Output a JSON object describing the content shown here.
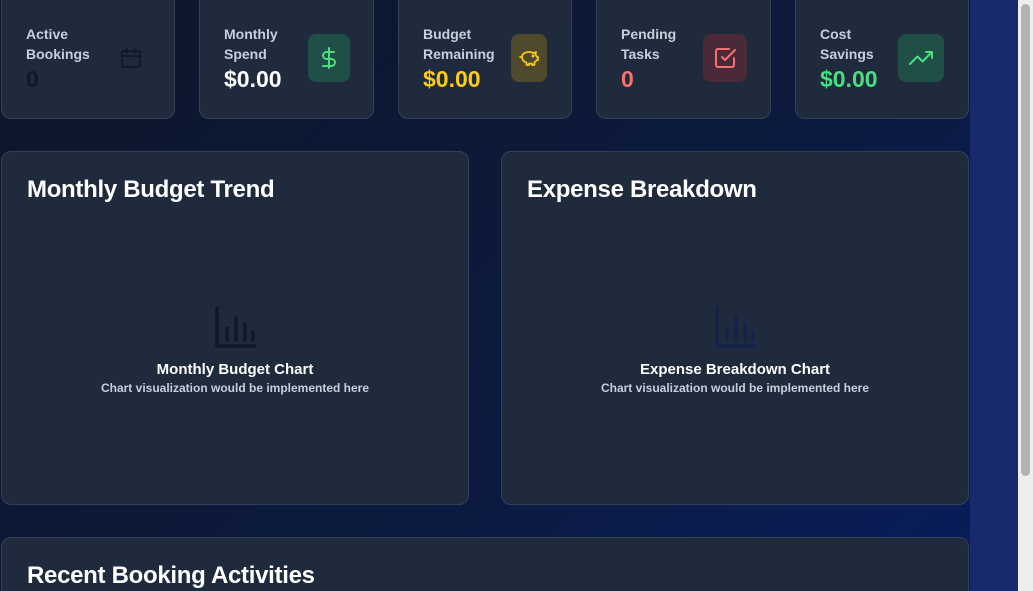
{
  "stats": [
    {
      "label": "Active Bookings",
      "value": "0",
      "icon": "calendar-icon",
      "value_color": "#111827"
    },
    {
      "label": "Monthly Spend",
      "value": "$0.00",
      "icon": "dollar-icon",
      "value_color": "#ffffff"
    },
    {
      "label": "Budget Remaining",
      "value": "$0.00",
      "icon": "piggy-bank-icon",
      "value_color": "#facc15"
    },
    {
      "label": "Pending Tasks",
      "value": "0",
      "icon": "check-square-icon",
      "value_color": "#f87171"
    },
    {
      "label": "Cost Savings",
      "value": "$0.00",
      "icon": "trending-up-icon",
      "value_color": "#4ade80"
    }
  ],
  "charts": {
    "monthly": {
      "title": "Monthly Budget Trend",
      "placeholder_title": "Monthly Budget Chart",
      "placeholder_sub": "Chart visualization would be implemented here",
      "icon": "bar-chart-icon"
    },
    "expense": {
      "title": "Expense Breakdown",
      "placeholder_title": "Expense Breakdown Chart",
      "placeholder_sub": "Chart visualization would be implemented here",
      "icon": "bar-chart-icon"
    }
  },
  "recent": {
    "title": "Recent Booking Activities"
  },
  "colors": {
    "card_bg": "#1f2a3c",
    "card_border": "#334156",
    "green": "#4ade80",
    "yellow": "#facc15",
    "red": "#f87171"
  }
}
